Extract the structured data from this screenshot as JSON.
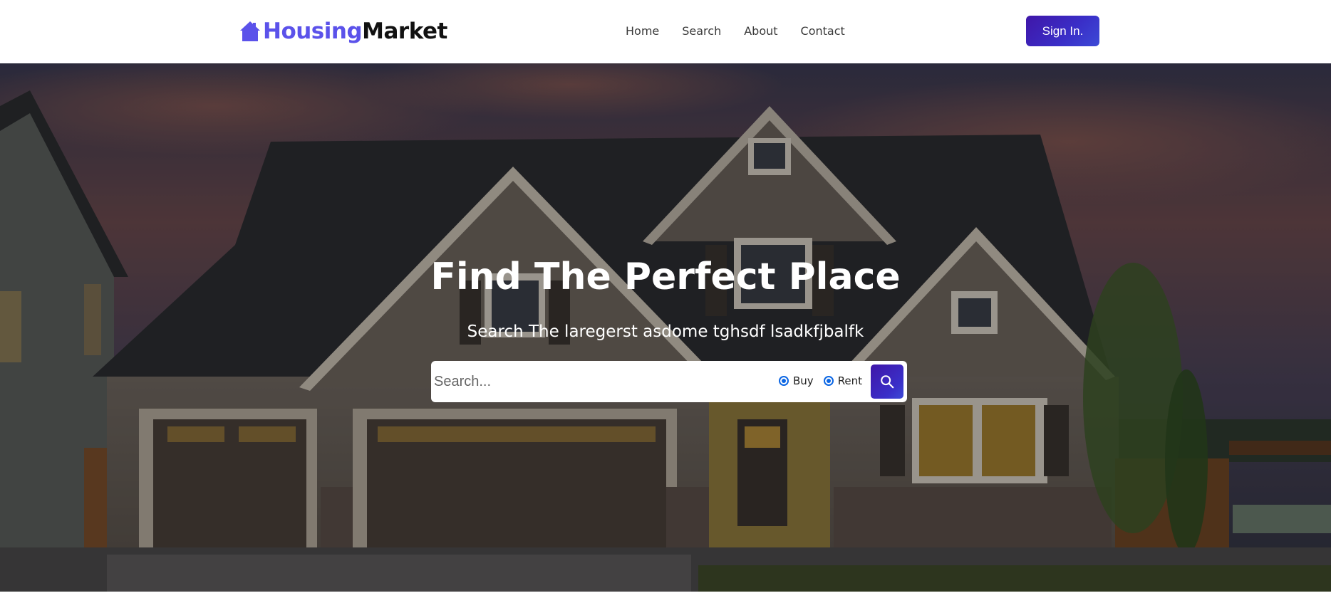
{
  "brand": {
    "part1": "Housing",
    "part2": "Market",
    "accent_color": "#5b52ea",
    "icon": "house-icon"
  },
  "nav": {
    "items": [
      {
        "label": "Home"
      },
      {
        "label": "Search"
      },
      {
        "label": "About"
      },
      {
        "label": "Contact"
      }
    ],
    "signin_label": "Sign In."
  },
  "hero": {
    "title": "Find The Perfect Place",
    "subtitle": "Search The laregerst asdome tghsdf lsadkfjbalfk",
    "search": {
      "placeholder": "Search...",
      "options": [
        {
          "label": "Buy",
          "checked": true
        },
        {
          "label": "Rent",
          "checked": true
        }
      ],
      "button_icon": "search-icon",
      "button_color": "#3a2fc8"
    }
  }
}
